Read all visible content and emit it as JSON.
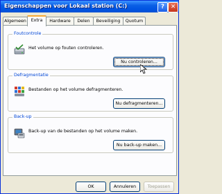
{
  "window": {
    "title": "Eigenschappen voor Lokaal station (C:)"
  },
  "titlebar_buttons": {
    "help": "?",
    "close": "✕"
  },
  "tabs": [
    {
      "label": "Algemeen"
    },
    {
      "label": "Extra",
      "active": true
    },
    {
      "label": "Hardware"
    },
    {
      "label": "Delen"
    },
    {
      "label": "Beveiliging"
    },
    {
      "label": "Quotum"
    }
  ],
  "groups": {
    "foutcontrole": {
      "label": "Foutcontrole",
      "text": "Het volume op fouten controleren.",
      "button": "Nu controleren...",
      "icon": "check-disk-icon"
    },
    "defragmentatie": {
      "label": "Defragmentatie",
      "text": "Bestanden op het volume defragmenteren.",
      "button": "Nu defragmenteren...",
      "icon": "defrag-icon"
    },
    "backup": {
      "label": "Back-up",
      "text": "Back-up van de bestanden op het volume maken.",
      "button": "Nu back-up maken...",
      "icon": "backup-icon"
    }
  },
  "footer": {
    "ok": "OK",
    "cancel": "Annuleren",
    "apply": "Toepassen"
  },
  "colors": {
    "titlebar": "#0a5fe5",
    "group_label": "#0046d5",
    "dialog_bg": "#ece9d8"
  }
}
